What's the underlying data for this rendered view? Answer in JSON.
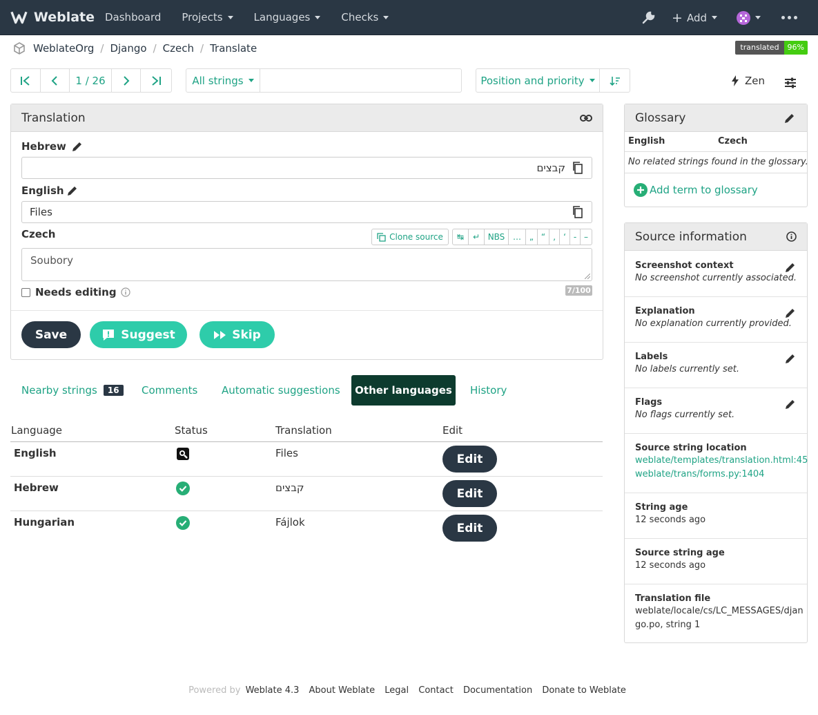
{
  "navbar": {
    "brand": "Weblate",
    "items": [
      "Dashboard",
      "Projects",
      "Languages",
      "Checks"
    ],
    "add_label": "Add"
  },
  "breadcrumb": [
    "WeblateOrg",
    "Django",
    "Czech",
    "Translate"
  ],
  "status_badge": {
    "label": "translated",
    "value": "96%"
  },
  "pager": {
    "position": "1 / 26"
  },
  "filter": {
    "label": "All strings",
    "search_value": ""
  },
  "sort": {
    "label": "Position and priority"
  },
  "zen_label": "Zen",
  "translation_panel": {
    "title": "Translation",
    "hebrew_label": "Hebrew",
    "hebrew_value": "קבצים",
    "english_label": "English",
    "english_value": "Files",
    "czech_label": "Czech",
    "clone_source": "Clone source",
    "special_chars": [
      "↹",
      "↵",
      "NBS",
      "…",
      "„",
      "“",
      "‚",
      "‘",
      "-",
      "–"
    ],
    "czech_value": "Soubory",
    "needs_editing": "Needs editing",
    "char_count": "7/100",
    "save": "Save",
    "suggest": "Suggest",
    "skip": "Skip"
  },
  "tabs": {
    "nearby": "Nearby strings",
    "nearby_count": "16",
    "comments": "Comments",
    "automatic": "Automatic suggestions",
    "other": "Other languages",
    "history": "History"
  },
  "languages_table": {
    "headers": [
      "Language",
      "Status",
      "Translation",
      "Edit"
    ],
    "rows": [
      {
        "language": "English",
        "status": "source-icon",
        "translation": "Files",
        "edit": "Edit"
      },
      {
        "language": "Hebrew",
        "status": "check-icon",
        "translation": "קבצים",
        "edit": "Edit"
      },
      {
        "language": "Hungarian",
        "status": "check-icon",
        "translation": "Fájlok",
        "edit": "Edit"
      }
    ]
  },
  "glossary": {
    "title": "Glossary",
    "col_source": "English",
    "col_target": "Czech",
    "empty": "No related strings found in the glossary.",
    "add": "Add term to glossary"
  },
  "source_info": {
    "title": "Source information",
    "screenshot_title": "Screenshot context",
    "screenshot_value": "No screenshot currently associated.",
    "explanation_title": "Explanation",
    "explanation_value": "No explanation currently provided.",
    "labels_title": "Labels",
    "labels_value": "No labels currently set.",
    "flags_title": "Flags",
    "flags_value": "No flags currently set.",
    "location_title": "Source string location",
    "location_1": "weblate/templates/translation.html:45",
    "location_2": "weblate/trans/forms.py:1404",
    "string_age_title": "String age",
    "string_age_value": "12 seconds ago",
    "source_age_title": "Source string age",
    "source_age_value": "12 seconds ago",
    "file_title": "Translation file",
    "file_value_1": "weblate/locale/cs/LC_MESSAGES/djan",
    "file_value_2": "go.po, string 1"
  },
  "footer": {
    "powered": "Powered by",
    "version": "Weblate 4.3",
    "links": [
      "About Weblate",
      "Legal",
      "Contact",
      "Documentation",
      "Donate to Weblate"
    ]
  },
  "colors": {
    "navbar": "#2a3744",
    "accent": "#1fa385",
    "button_green": "#2eccaa",
    "badge_green": "#44cc11"
  }
}
